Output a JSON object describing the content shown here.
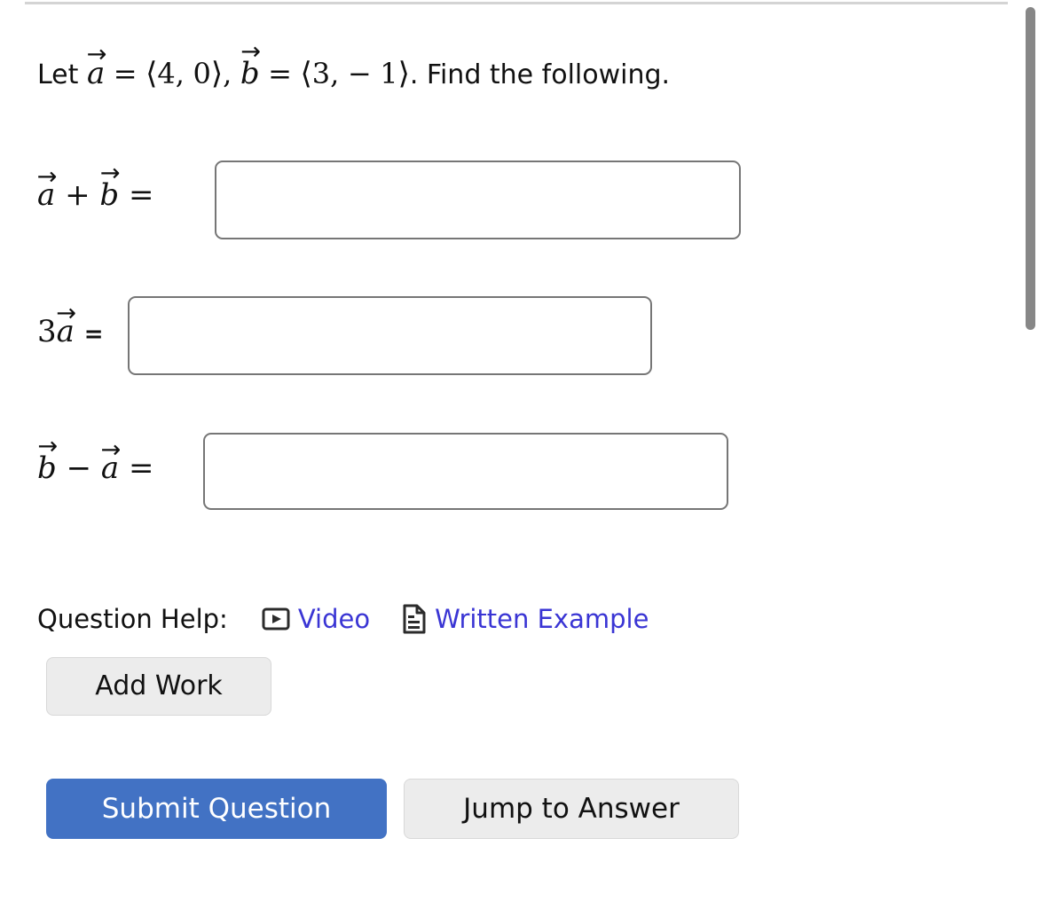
{
  "question": {
    "prompt": {
      "lead": "Let",
      "vector_a_name": "a",
      "eq1": "=",
      "a_open": "⟨",
      "a_x": "4",
      "a_comma": ",",
      "a_y": "0",
      "a_close": "⟩",
      "sep": ",",
      "vector_b_name": "b",
      "eq2": "=",
      "b_open": "⟨",
      "b_x": "3",
      "b_comma": ",",
      "b_minus": "−",
      "b_y": "1",
      "b_close": "⟩",
      "tail": ". Find the following.",
      "full_text": "Let a⃗ = ⟨4, 0⟩, b⃗ = ⟨3, − 1⟩. Find the following."
    },
    "vectors": {
      "a": [
        4,
        0
      ],
      "b": [
        3,
        -1
      ]
    }
  },
  "parts": [
    {
      "id": "a-plus-b",
      "label_text": "a⃗ + b⃗ =",
      "left_vec": "a",
      "operator": "+",
      "right_vec": "b",
      "equals": "=",
      "answer_value": "",
      "answer_placeholder": ""
    },
    {
      "id": "three-a",
      "label_text": "3a⃗ =",
      "scalar": "3",
      "left_vec": "a",
      "equals": "=",
      "answer_value": "",
      "answer_placeholder": ""
    },
    {
      "id": "b-minus-a",
      "label_text": "b⃗ − a⃗ =",
      "left_vec": "b",
      "operator": "−",
      "right_vec": "a",
      "equals": "=",
      "answer_value": "",
      "answer_placeholder": ""
    }
  ],
  "help": {
    "label": "Question Help:",
    "video_link": "Video",
    "video_icon": "video-play-icon",
    "written_link": "Written Example",
    "written_icon": "document-lines-icon"
  },
  "buttons": {
    "add_work": "Add Work",
    "submit": "Submit Question",
    "jump": "Jump to Answer"
  },
  "colors": {
    "link": "#3a35d4",
    "primary_button_bg": "#4272c4",
    "primary_button_text": "#ffffff",
    "secondary_button_bg": "#ececec",
    "input_border": "#767676",
    "scrollbar_thumb": "#878787",
    "text": "#111111"
  },
  "arrow_glyph": "→"
}
